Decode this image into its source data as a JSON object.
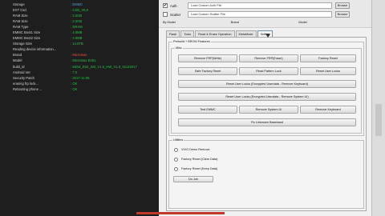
{
  "log": [
    {
      "key": "Storage",
      "value": ": EMMC",
      "color": "blue"
    },
    {
      "key": "EXT Csd",
      "value": ": CSD_V5.0",
      "color": "green"
    },
    {
      "key": "RAM Size",
      "value": ": 2.0GB",
      "color": "green"
    },
    {
      "key": "RAM Size",
      "value": ": 2.0GB",
      "color": "green"
    },
    {
      "key": "RAM Type",
      "value": ": DRAM",
      "color": "green"
    },
    {
      "key": "EMMC Boot1 Size",
      "value": ": 4.0MB",
      "color": "green"
    },
    {
      "key": "EMMC Boot2 Size",
      "value": ": 4.0MB",
      "color": "green"
    },
    {
      "key": "Storage Size",
      "value": ": 14.6TB",
      "color": "green"
    },
    {
      "key": "Reading device information...",
      "value": "",
      "color": "green"
    },
    {
      "key": "Brand",
      "value": ": Micromax",
      "color": "red"
    },
    {
      "key": "Model",
      "value": ": Micromax E451",
      "color": "green"
    },
    {
      "key": "build_id",
      "value": ": MISS_E02_SM_V1.5_HW_V1.0_01122017",
      "color": "green"
    },
    {
      "key": "Android Ver",
      "value": ": 7.0",
      "color": "green"
    },
    {
      "key": "Security Patch",
      "value": ": 2017-11-05",
      "color": "green"
    },
    {
      "key": "erasing frp lock...",
      "value": ": OK",
      "color": "green"
    },
    {
      "key": "Rebooting phone ...",
      "value": ": OK",
      "color": "green"
    }
  ],
  "top": {
    "auth_label": "Auth",
    "auth_checked": "✔",
    "auth_placeholder": "Load Custom Auth File",
    "scatter_label": "Scatter",
    "scatter_placeholder": "Load Custom Scatter File",
    "browse": "Browse",
    "by_model": "By Model",
    "brand": "Brand",
    "model": "Model"
  },
  "tabs": [
    {
      "label": "Flash"
    },
    {
      "label": "Tools"
    },
    {
      "label": "Read & Erase Operation"
    },
    {
      "label": "MetaMode"
    },
    {
      "label": "Setting"
    }
  ],
  "group_title": "Prebuild + BROM Features",
  "misc_title": "Misc",
  "buttons": {
    "remove_frp_write": "Remove FRP(Write)",
    "remove_frp_erase": "Remove FRP(Erase)",
    "factory_reset": "Factory Reset",
    "safe_factory_reset": "Safe Factory Reset",
    "read_pattern_lock": "Read Pattern Lock",
    "reset_user_locks": "Reset User Locks",
    "reset_user_locks_enc_userdata": "Reset User Locks (Encrypted Userdata - Remove Keyboard)",
    "reset_user_locks_enc_userdata_2": "Reset User Locks (Encrypted Userdata - Remove System UI)",
    "test_emmc": "Test EMMC",
    "remove_system_ui": "Remove System UI",
    "remove_keyboard": "Remove Keyboard",
    "fix_unknown_baseband": "Fix Unknown Baseband"
  },
  "utilities": {
    "title": "Utilities",
    "options": [
      "VIVO Demo Remove",
      "Factory Reset (Clear Data)",
      "Factory Reset (Keep Data)"
    ],
    "go_label": "Do Job"
  },
  "colors": {
    "log_bg": "#1e1e1e",
    "log_green": "#2ec04a",
    "log_blue": "#4aa3df",
    "log_red": "#ff4b3c",
    "panel_bg": "#f0f0f0"
  }
}
